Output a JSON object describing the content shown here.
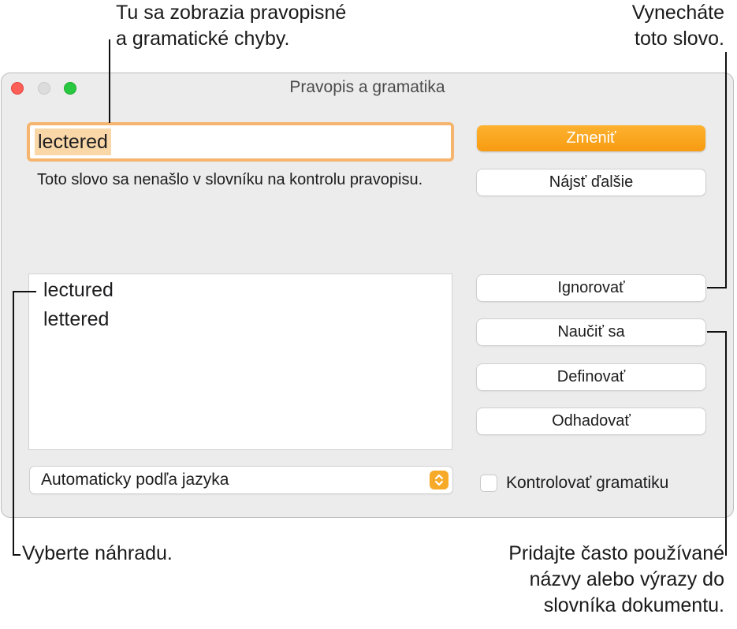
{
  "callouts": {
    "top_left": [
      "Tu sa zobrazia pravopisné",
      "a gramatické chyby."
    ],
    "top_right": [
      "Vynecháte",
      "toto slovo."
    ],
    "bottom_left": [
      "Vyberte náhradu."
    ],
    "bottom_right": [
      "Pridajte často používané",
      "názvy alebo výrazy do",
      "slovníka dokumentu."
    ]
  },
  "window": {
    "title": "Pravopis a gramatika"
  },
  "word_field": {
    "value": "lectered"
  },
  "message": "Toto slovo sa nenašlo v slovníku na kontrolu pravopisu.",
  "suggestions": [
    "lectured",
    "lettered"
  ],
  "language_select": {
    "value": "Automaticky podľa jazyka"
  },
  "buttons": {
    "change": "Zmeniť",
    "find_next": "Nájsť ďalšie",
    "ignore": "Ignorovať",
    "learn": "Naučiť sa",
    "define": "Definovať",
    "guess": "Odhadovať"
  },
  "grammar_checkbox": {
    "label": "Kontrolovať gramatiku",
    "checked": false
  },
  "colors": {
    "accent": "#f7a928",
    "highlight": "#f9d7a7",
    "focus_ring": "#f5b56e"
  }
}
